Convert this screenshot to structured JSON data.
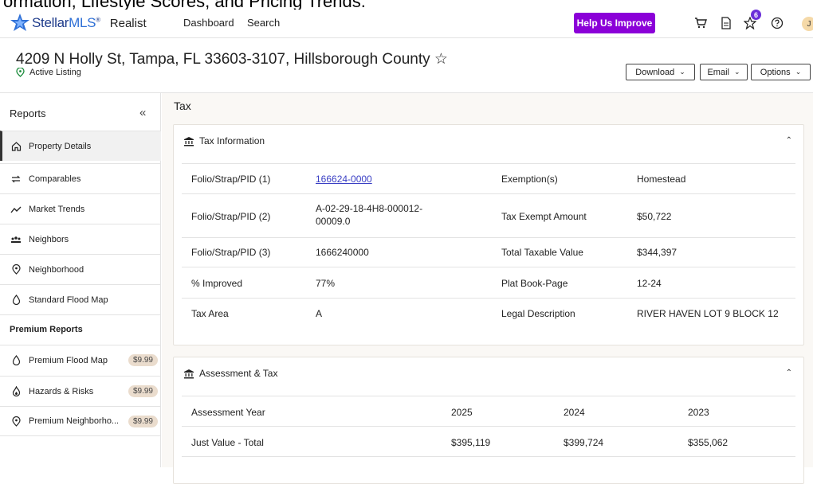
{
  "caption": "ormation, Lifestyle Scores, and Pricing Trends.",
  "brand": {
    "logo_main": "Stellar",
    "logo_mls": "MLS",
    "logo_mark": "®",
    "product": "Realist"
  },
  "nav": {
    "dashboard": "Dashboard",
    "search": "Search"
  },
  "header_actions": {
    "help": "Help Us Improve",
    "favorites_badge": "6",
    "avatar_initial": "J",
    "icons": [
      "cart-icon",
      "document-icon",
      "star-icon",
      "help-circle-icon"
    ]
  },
  "property": {
    "address": "4209 N Holly St, Tampa, FL 33603-3107, Hillsborough County ☆",
    "status": "Active Listing",
    "buttons": {
      "download": "Download",
      "email": "Email",
      "options": "Options"
    }
  },
  "sidebar": {
    "title": "Reports",
    "collapse": "«",
    "items": [
      {
        "label": "Property Details",
        "icon": "home-icon",
        "active": true
      },
      {
        "label": "Comparables",
        "icon": "swap-icon"
      },
      {
        "label": "Market Trends",
        "icon": "trend-icon"
      },
      {
        "label": "Neighbors",
        "icon": "people-icon"
      },
      {
        "label": "Neighborhood",
        "icon": "location-icon"
      },
      {
        "label": "Standard Flood Map",
        "icon": "drop-icon"
      }
    ],
    "premium_title": "Premium Reports",
    "premium_items": [
      {
        "label": "Premium Flood Map",
        "price": "$9.99",
        "icon": "drop-icon"
      },
      {
        "label": "Hazards & Risks",
        "price": "$9.99",
        "icon": "fire-icon"
      },
      {
        "label": "Premium Neighborho...",
        "price": "$9.99",
        "icon": "location-icon"
      }
    ]
  },
  "main": {
    "section_title": "Tax",
    "tax_info": {
      "title": "Tax Information",
      "rows": [
        {
          "k1": "Folio/Strap/PID (1)",
          "v1": "166624-0000",
          "k2": "Exemption(s)",
          "v2": "Homestead"
        },
        {
          "k1": "Folio/Strap/PID (2)",
          "v1a": "A-02-29-18-4H8-000012-",
          "v1b": "00009.0",
          "k2": "Tax Exempt Amount",
          "v2": "$50,722"
        },
        {
          "k1": "Folio/Strap/PID (3)",
          "v1": "1666240000",
          "k2": "Total Taxable Value",
          "v2": "$344,397"
        },
        {
          "k1": "% Improved",
          "v1": "77%",
          "k2": "Plat Book-Page",
          "v2": "12-24"
        },
        {
          "k1": "Tax Area",
          "v1": "A",
          "k2": "Legal Description",
          "v2": "RIVER HAVEN LOT 9 BLOCK 12"
        }
      ]
    },
    "assessment": {
      "title": "Assessment & Tax",
      "header": {
        "label": "Assessment Year",
        "y1": "2025",
        "y2": "2024",
        "y3": "2023"
      },
      "rows": [
        {
          "label": "Just Value - Total",
          "y1": "$395,119",
          "y2": "$399,724",
          "y3": "$355,062"
        }
      ]
    }
  }
}
